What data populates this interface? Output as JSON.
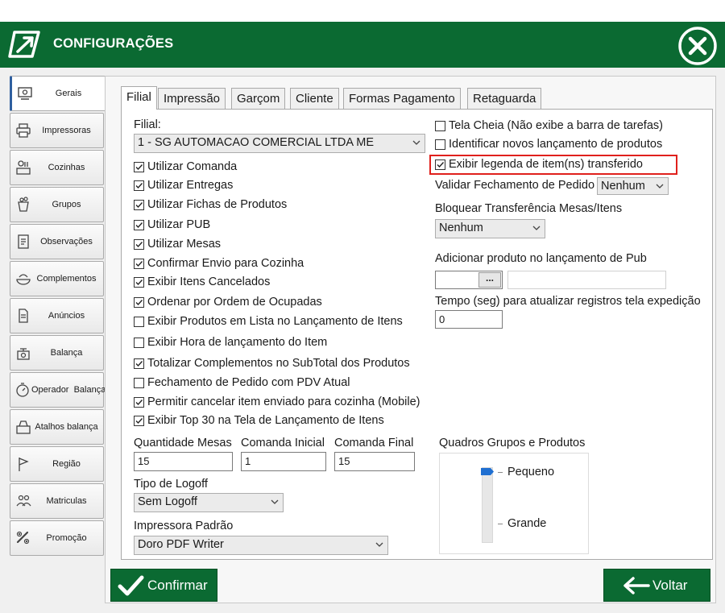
{
  "window": {
    "title": "CONFIGURAÇÕES"
  },
  "sidebar": {
    "items": [
      {
        "label": "Gerais",
        "icon": "gear-settings-icon"
      },
      {
        "label": "Impressoras",
        "icon": "printer-icon"
      },
      {
        "label": "Cozinhas",
        "icon": "kitchen-icon"
      },
      {
        "label": "Grupos",
        "icon": "groups-icon"
      },
      {
        "label": "Observações",
        "icon": "notes-icon"
      },
      {
        "label": "Complementos",
        "icon": "complements-icon"
      },
      {
        "label": "Anúncios",
        "icon": "document-icon"
      },
      {
        "label": "Balança",
        "icon": "scale-icon"
      },
      {
        "label": "Operador  Balança",
        "icon": "stopwatch-icon"
      },
      {
        "label": "Atalhos balança",
        "icon": "scale-shortcut-icon"
      },
      {
        "label": "Região",
        "icon": "flag-icon"
      },
      {
        "label": "Matriculas",
        "icon": "registrations-icon"
      },
      {
        "label": "Promoção",
        "icon": "promotion-icon"
      }
    ]
  },
  "tabs": [
    {
      "label": "Filial"
    },
    {
      "label": "Impressão"
    },
    {
      "label": "Garçom"
    },
    {
      "label": "Cliente"
    },
    {
      "label": "Formas Pagamento"
    },
    {
      "label": "Retaguarda"
    }
  ],
  "filial": {
    "label": "Filial:",
    "value": "1 - SG AUTOMACAO COMERCIAL LTDA ME"
  },
  "left_checkboxes": [
    {
      "label": "Utilizar Comanda",
      "checked": true
    },
    {
      "label": "Utilizar Entregas",
      "checked": true
    },
    {
      "label": "Utilizar Fichas de Produtos",
      "checked": true
    },
    {
      "label": "Utilizar PUB",
      "checked": true
    },
    {
      "label": "Utilizar Mesas",
      "checked": true
    },
    {
      "label": "Confirmar Envio para Cozinha",
      "checked": true
    },
    {
      "label": "Exibir Itens Cancelados",
      "checked": true
    },
    {
      "label": "Ordenar por Ordem de Ocupadas",
      "checked": true
    },
    {
      "label": "Exibir Produtos em Lista no Lançamento de Itens",
      "checked": false
    },
    {
      "label": "Exibir Hora de lançamento do Item",
      "checked": false
    },
    {
      "label": "Totalizar Complementos no SubTotal dos Produtos",
      "checked": true
    },
    {
      "label": "Fechamento de Pedido com PDV Atual",
      "checked": false
    },
    {
      "label": "Permitir cancelar item enviado para cozinha (Mobile)",
      "checked": true
    },
    {
      "label": "Exibir Top 30 na Tela de Lançamento de Itens",
      "checked": true
    }
  ],
  "right_checkboxes": [
    {
      "label": "Tela Cheia (Não exibe a barra de tarefas)",
      "checked": false
    },
    {
      "label": "Identificar novos lançamento de produtos",
      "checked": false
    },
    {
      "label": "Exibir legenda de item(ns) transferido",
      "checked": true
    }
  ],
  "validar": {
    "label": "Validar Fechamento de Pedido",
    "value": "Nenhum"
  },
  "bloquear": {
    "label": "Bloquear Transferência Mesas/Itens",
    "value": "Nenhum"
  },
  "adicionar": {
    "label": "Adicionar produto no lançamento de Pub",
    "button": "...",
    "code": "",
    "name": ""
  },
  "tempo": {
    "label": "Tempo (seg) para atualizar registros tela expedição",
    "value": "0"
  },
  "quantidades": {
    "mesas_label": "Quantidade Mesas",
    "mesas_value": "15",
    "inicial_label": "Comanda Inicial",
    "inicial_value": "1",
    "final_label": "Comanda Final",
    "final_value": "15"
  },
  "logoff": {
    "label": "Tipo de Logoff",
    "value": "Sem Logoff"
  },
  "impressora": {
    "label": "Impressora Padrão",
    "value": "Doro PDF Writer"
  },
  "quadros": {
    "label": "Quadros Grupos e Produtos",
    "min_label": "Pequeno",
    "max_label": "Grande",
    "level": 0
  },
  "buttons": {
    "confirm": "Confirmar",
    "back": "Voltar"
  },
  "colors": {
    "brand": "#0b6a32",
    "highlight": "#e0201c",
    "slider_thumb": "#1f6fd1"
  }
}
